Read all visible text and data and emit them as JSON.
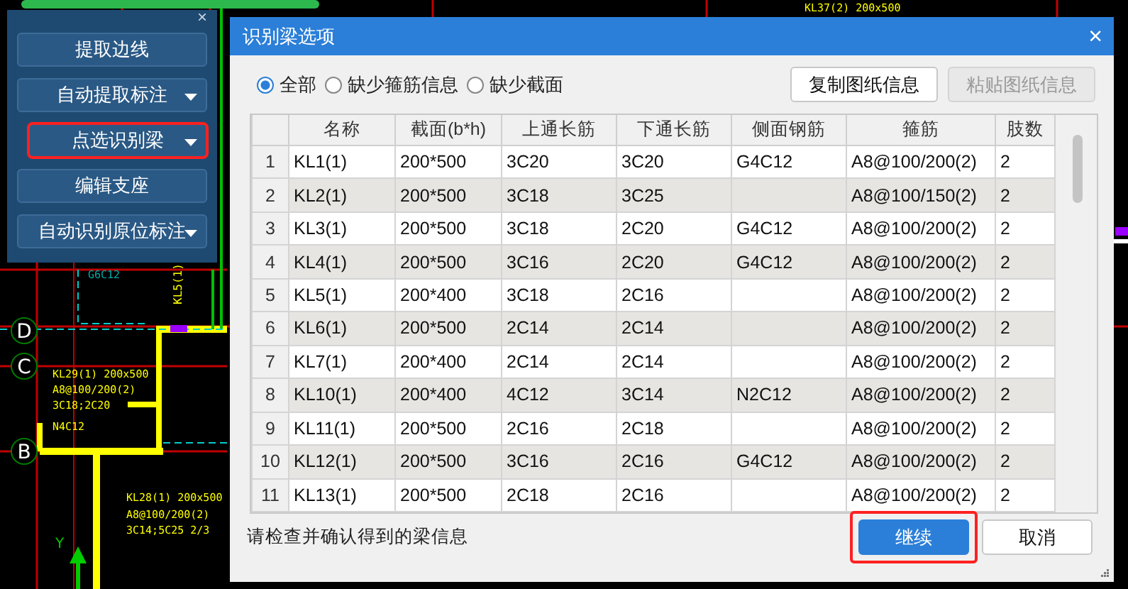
{
  "cad": {
    "labels": [
      {
        "text": "KL37(2) 200x500",
        "kind": "plain"
      },
      {
        "text": "G6C12",
        "kind": "cyan"
      },
      {
        "text": "KL5(1)",
        "kind": "vertical"
      },
      {
        "text": "KL29(1) 200x500",
        "kind": "plain"
      },
      {
        "text": "A8@100/200(2)",
        "kind": "plain"
      },
      {
        "text": "3C18;2C20",
        "kind": "plain"
      },
      {
        "text": "N4C12",
        "kind": "plain"
      },
      {
        "text": "KL28(1) 200x500",
        "kind": "plain"
      },
      {
        "text": "A8@100/200(2)",
        "kind": "plain"
      },
      {
        "text": "3C14;5C25 2/3",
        "kind": "plain"
      }
    ],
    "axes": [
      {
        "text": "D"
      },
      {
        "text": "C"
      },
      {
        "text": "B"
      }
    ],
    "axis_y_label": "Y"
  },
  "panel": {
    "close": "×",
    "buttons": [
      {
        "label": "提取边线",
        "has_menu": false,
        "highlighted": false
      },
      {
        "label": "自动提取标注",
        "has_menu": true,
        "highlighted": false
      },
      {
        "label": "点选识别梁",
        "has_menu": true,
        "highlighted": true
      },
      {
        "label": "编辑支座",
        "has_menu": false,
        "highlighted": false
      },
      {
        "label": "自动识别原位标注",
        "has_menu": true,
        "highlighted": false
      }
    ]
  },
  "dialog": {
    "title": "识别梁选项",
    "close": "×",
    "filters": [
      {
        "label": "全部",
        "selected": true
      },
      {
        "label": "缺少箍筋信息",
        "selected": false
      },
      {
        "label": "缺少截面",
        "selected": false
      }
    ],
    "actions": [
      {
        "label": "复制图纸信息",
        "disabled": false
      },
      {
        "label": "粘贴图纸信息",
        "disabled": true
      }
    ],
    "table": {
      "columns": [
        "名称",
        "截面(b*h)",
        "上通长筋",
        "下通长筋",
        "侧面钢筋",
        "箍筋",
        "肢数"
      ],
      "rows": [
        {
          "no": "1",
          "cells": [
            "KL1(1)",
            "200*500",
            "3C20",
            "3C20",
            "G4C12",
            "A8@100/200(2)",
            "2"
          ]
        },
        {
          "no": "2",
          "cells": [
            "KL2(1)",
            "200*500",
            "3C18",
            "3C25",
            null,
            "A8@100/150(2)",
            "2"
          ]
        },
        {
          "no": "3",
          "cells": [
            "KL3(1)",
            "200*500",
            "3C18",
            "2C20",
            "G4C12",
            "A8@100/200(2)",
            "2"
          ]
        },
        {
          "no": "4",
          "cells": [
            "KL4(1)",
            "200*500",
            "3C16",
            "2C20",
            "G4C12",
            "A8@100/200(2)",
            "2"
          ]
        },
        {
          "no": "5",
          "cells": [
            "KL5(1)",
            "200*400",
            "3C18",
            "2C16",
            null,
            "A8@100/200(2)",
            "2"
          ]
        },
        {
          "no": "6",
          "cells": [
            "KL6(1)",
            "200*500",
            "2C14",
            "2C14",
            null,
            "A8@100/200(2)",
            "2"
          ]
        },
        {
          "no": "7",
          "cells": [
            "KL7(1)",
            "200*400",
            "2C14",
            "2C14",
            null,
            "A8@100/200(2)",
            "2"
          ]
        },
        {
          "no": "8",
          "cells": [
            "KL10(1)",
            "200*400",
            "4C12",
            "3C14",
            "N2C12",
            "A8@100/200(2)",
            "2"
          ]
        },
        {
          "no": "9",
          "cells": [
            "KL11(1)",
            "200*500",
            "2C16",
            "2C18",
            null,
            "A8@100/200(2)",
            "2"
          ]
        },
        {
          "no": "10",
          "cells": [
            "KL12(1)",
            "200*500",
            "3C16",
            "2C16",
            "G4C12",
            "A8@100/200(2)",
            "2"
          ]
        },
        {
          "no": "11",
          "cells": [
            "KL13(1)",
            "200*500",
            "2C18",
            "2C16",
            null,
            "A8@100/200(2)",
            "2"
          ]
        }
      ]
    },
    "hint": "请检查并确认得到的梁信息",
    "buttons": [
      {
        "label": "继续",
        "kind": "primary",
        "highlighted": true
      },
      {
        "label": "取消",
        "kind": "secondary",
        "highlighted": false
      }
    ]
  }
}
